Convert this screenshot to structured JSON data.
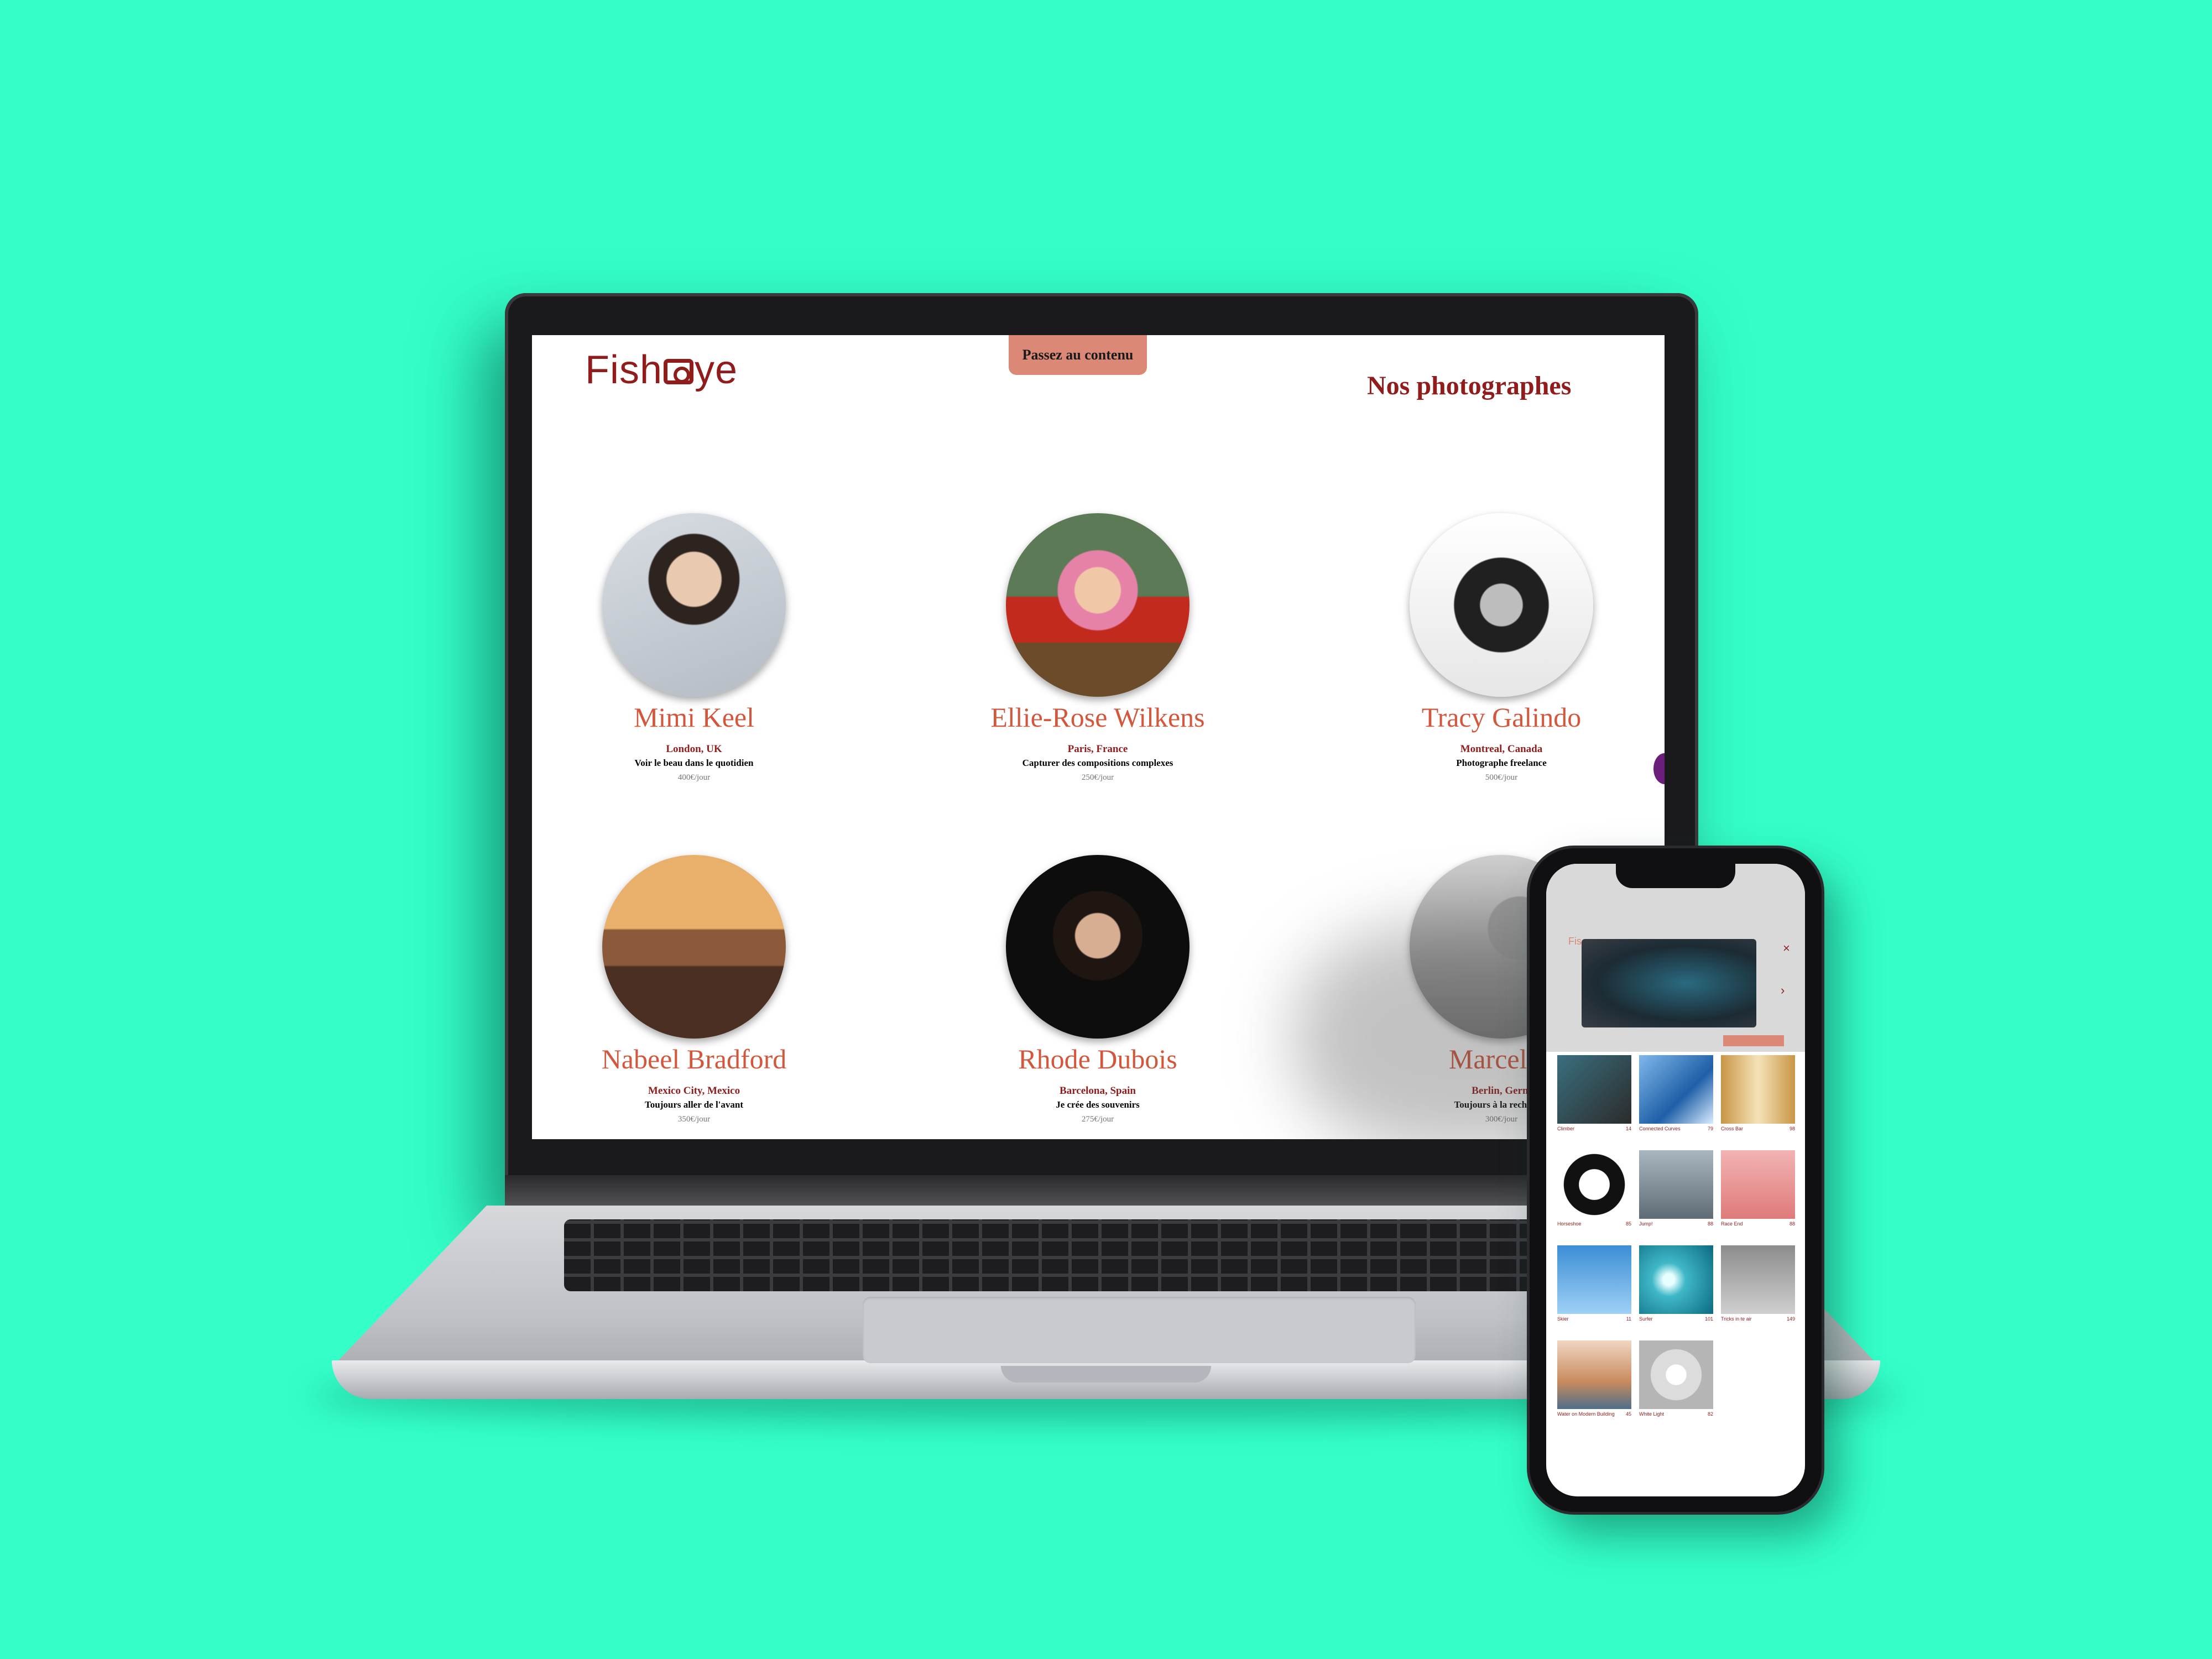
{
  "colors": {
    "background": "#34ffc9",
    "brand": "#901c1c",
    "accent": "#db8876",
    "name": "#d3573c"
  },
  "site": {
    "logo": "Fisheye",
    "skip_link": "Passez au contenu",
    "title": "Nos photographes"
  },
  "photographers": [
    {
      "name": "Mimi Keel",
      "location": "London, UK",
      "tagline": "Voir le beau dans le quotidien",
      "price": "400€/jour"
    },
    {
      "name": "Ellie-Rose Wilkens",
      "location": "Paris, France",
      "tagline": "Capturer des compositions complexes",
      "price": "250€/jour"
    },
    {
      "name": "Tracy Galindo",
      "location": "Montreal, Canada",
      "tagline": "Photographe freelance",
      "price": "500€/jour"
    },
    {
      "name": "Nabeel Bradford",
      "location": "Mexico City, Mexico",
      "tagline": "Toujours aller de l'avant",
      "price": "350€/jour"
    },
    {
      "name": "Rhode Dubois",
      "location": "Barcelona, Spain",
      "tagline": "Je crée des souvenirs",
      "price": "275€/jour"
    },
    {
      "name": "Marcel N",
      "location": "Berlin, Germ",
      "tagline": "Toujours à la recherche",
      "price": "300€/jour"
    }
  ],
  "phone": {
    "logo_fragment": "Fis",
    "close": "×",
    "next": "›",
    "media": [
      {
        "title": "Climber",
        "likes": "14"
      },
      {
        "title": "Connected Curves",
        "likes": "79"
      },
      {
        "title": "Cross Bar",
        "likes": "98"
      },
      {
        "title": "Horseshoe",
        "likes": "85"
      },
      {
        "title": "Jump!",
        "likes": "88"
      },
      {
        "title": "Race End",
        "likes": "88"
      },
      {
        "title": "Skier",
        "likes": "11"
      },
      {
        "title": "Surfer",
        "likes": "101"
      },
      {
        "title": "Tricks in te air",
        "likes": "149"
      },
      {
        "title": "Water on Modern Building",
        "likes": "45"
      },
      {
        "title": "White Light",
        "likes": "82"
      }
    ]
  }
}
